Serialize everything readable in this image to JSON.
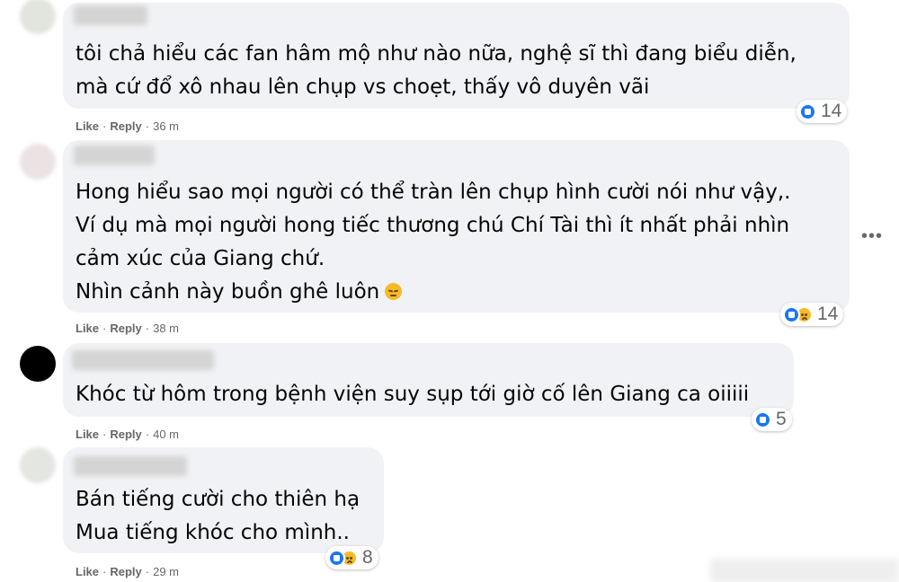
{
  "comments": [
    {
      "lines": [
        "tôi chả hiểu các fan hâm mộ như nào nữa, nghệ sĩ thì đang biểu diễn,",
        "mà cứ đổ xô nhau lên chụp vs choẹt, thấy vô duyên vãi"
      ],
      "actions": {
        "like": "Like",
        "reply": "Reply",
        "time": "36 m"
      },
      "reaction_count": "14",
      "reactions": [
        "like"
      ]
    },
    {
      "lines": [
        "Hong hiểu sao mọi người có thể tràn lên chụp hình cười nói như vậy,.",
        "Ví dụ mà mọi người hong tiếc thương chú Chí Tài thì ít nhất phải nhìn",
        "cảm xúc của Giang chứ.",
        "Nhìn cảnh này buồn ghê luôn"
      ],
      "actions": {
        "like": "Like",
        "reply": "Reply",
        "time": "38 m"
      },
      "reaction_count": "14",
      "reactions": [
        "like",
        "sad"
      ]
    },
    {
      "lines": [
        "Khóc từ hôm trong bệnh viện suy sụp tới giờ cố lên Giang ca oiiiii"
      ],
      "actions": {
        "like": "Like",
        "reply": "Reply",
        "time": "40 m"
      },
      "reaction_count": "5",
      "reactions": [
        "like"
      ]
    },
    {
      "lines": [
        "Bán tiếng cười cho thiên hạ",
        "Mua tiếng khóc cho mình.."
      ],
      "actions": {
        "like": "Like",
        "reply": "Reply",
        "time": "29 m"
      },
      "reaction_count": "8",
      "reactions": [
        "like",
        "sad"
      ]
    }
  ],
  "more_icon": "more-horizontal-icon",
  "colors": {
    "bubble": "#f0f2f5",
    "like_blue": "#1877f2",
    "sad_yellow": "#f7b928",
    "meta_gray": "#65676b"
  }
}
